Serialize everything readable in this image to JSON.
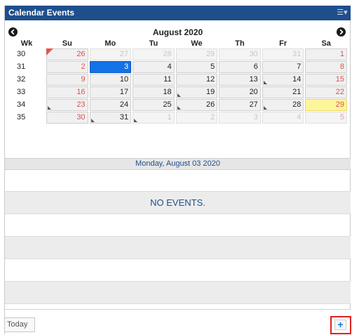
{
  "widget": {
    "title": "Calendar Events",
    "menu_icon": "menu-dropdown-icon"
  },
  "calendar": {
    "month_label": "August 2020",
    "prev_icon": "chevron-left-circle-icon",
    "next_icon": "chevron-right-circle-icon",
    "headers": [
      "Wk",
      "Su",
      "Mo",
      "Tu",
      "We",
      "Th",
      "Fr",
      "Sa"
    ],
    "weeks": [
      {
        "wk": "30",
        "days": [
          "26",
          "27",
          "28",
          "29",
          "30",
          "31",
          "1"
        ]
      },
      {
        "wk": "31",
        "days": [
          "2",
          "3",
          "4",
          "5",
          "6",
          "7",
          "8"
        ]
      },
      {
        "wk": "32",
        "days": [
          "9",
          "10",
          "11",
          "12",
          "13",
          "14",
          "15"
        ]
      },
      {
        "wk": "33",
        "days": [
          "16",
          "17",
          "18",
          "19",
          "20",
          "21",
          "22"
        ]
      },
      {
        "wk": "34",
        "days": [
          "23",
          "24",
          "25",
          "26",
          "27",
          "28",
          "29"
        ]
      },
      {
        "wk": "35",
        "days": [
          "30",
          "31",
          "1",
          "2",
          "3",
          "4",
          "5"
        ]
      }
    ],
    "selected_date_label": "Monday, August 03 2020"
  },
  "events": {
    "empty_message": "NO EVENTS."
  },
  "footer": {
    "today_label": "Today",
    "add_label": "+"
  }
}
